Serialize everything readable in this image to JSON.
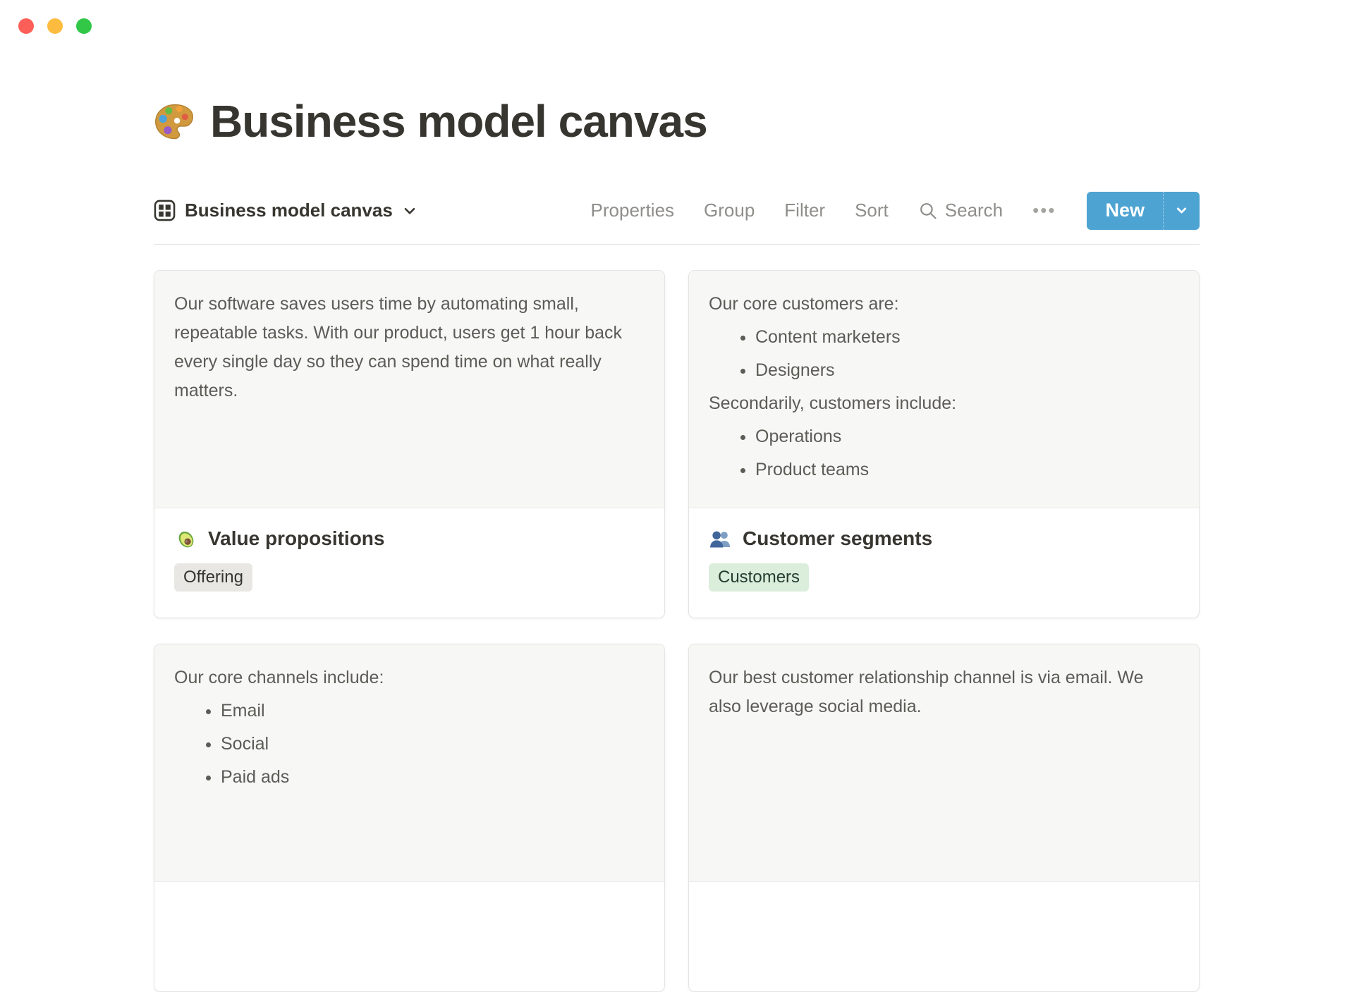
{
  "window": {
    "controls": [
      {
        "name": "close",
        "color": "#FC5F57"
      },
      {
        "name": "minimize",
        "color": "#FDBC40"
      },
      {
        "name": "zoom",
        "color": "#33C748"
      }
    ]
  },
  "page": {
    "icon": "palette-icon",
    "icon_char": "🎨",
    "title": "Business model canvas"
  },
  "toolbar": {
    "view": {
      "icon": "gallery-view-icon",
      "label": "Business model canvas"
    },
    "menu_items": [
      "Properties",
      "Group",
      "Filter",
      "Sort"
    ],
    "search": {
      "icon": "search-icon",
      "label": "Search"
    },
    "more": "•••",
    "new_button": {
      "label": "New",
      "color": "#4DA3D2"
    }
  },
  "gallery": {
    "cards": [
      {
        "preview_blocks": [
          {
            "type": "p",
            "text": "Our software saves users time by automating small, repeatable tasks. With our product, users get 1 hour back every single day so they can spend time on what really matters."
          }
        ],
        "icon": "avocado-icon",
        "icon_char": "🥑",
        "title": "Value propositions",
        "tags": [
          {
            "label": "Offering",
            "bg": "#E8E7E4",
            "text_color": "#37352F"
          }
        ]
      },
      {
        "preview_blocks": [
          {
            "type": "p",
            "text": "Our core customers are:"
          },
          {
            "type": "ul",
            "items": [
              "Content marketers",
              "Designers"
            ]
          },
          {
            "type": "p",
            "text": "Secondarily, customers include:"
          },
          {
            "type": "ul",
            "items": [
              "Operations",
              "Product teams"
            ]
          }
        ],
        "icon": "busts-icon",
        "icon_char": "👥",
        "title": "Customer segments",
        "tags": [
          {
            "label": "Customers",
            "bg": "#DBEDDB",
            "text_color": "#243D30"
          }
        ]
      },
      {
        "preview_blocks": [
          {
            "type": "p",
            "text": "Our core channels include:"
          },
          {
            "type": "ul",
            "items": [
              "Email",
              "Social",
              "Paid ads"
            ]
          }
        ]
      },
      {
        "preview_blocks": [
          {
            "type": "p",
            "text": "Our best customer relationship channel is via email. We also leverage social media."
          }
        ]
      }
    ]
  }
}
